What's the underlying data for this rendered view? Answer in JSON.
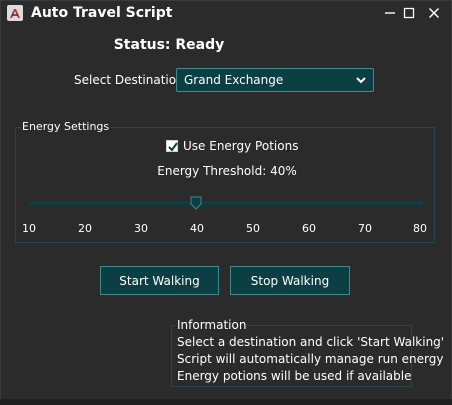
{
  "window": {
    "title": "Auto Travel Script",
    "icons": [
      "app-icon",
      "minimize-icon",
      "maximize-icon",
      "close-icon"
    ]
  },
  "status": {
    "text": "Status: Ready"
  },
  "destination": {
    "label": "Select Destination:",
    "selected": "Grand Exchange"
  },
  "energy": {
    "group_title": "Energy Settings",
    "use_potions_label": "Use Energy Potions",
    "use_potions_checked": true,
    "threshold_label": "Energy Threshold: 40%",
    "slider": {
      "min": 10,
      "max": 80,
      "value": 40
    },
    "ticks": [
      "10",
      "20",
      "30",
      "40",
      "50",
      "60",
      "70",
      "80"
    ]
  },
  "buttons": {
    "start": "Start Walking",
    "stop": "Stop Walking"
  },
  "info": {
    "title": "Information",
    "lines": [
      "Select a destination and click 'Start Walking'",
      "Script will automatically manage run energy",
      "Energy potions will be used if available"
    ]
  },
  "colors": {
    "background": "#2b2b2b",
    "accent": "#0c3f43",
    "accent_border": "#3e8a8e",
    "text": "#ffffff"
  }
}
